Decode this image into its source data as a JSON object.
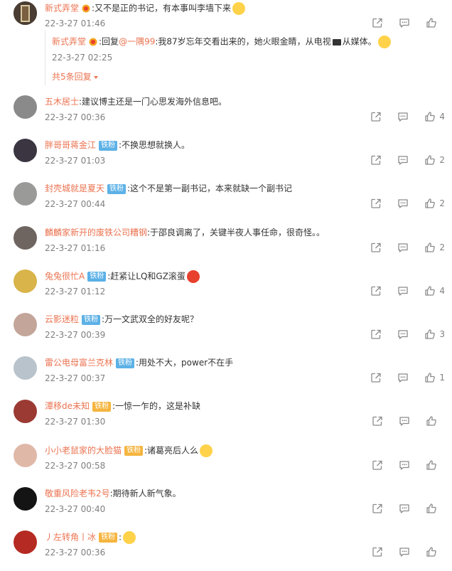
{
  "top_comment": {
    "user": "新式弄堂",
    "text": ":又不是正的书记，有本事叫李墙下来",
    "time": "22-3-27 01:46",
    "reply": {
      "user": "新式弄堂",
      "prefix": ":回复",
      "mention": "@一隅99",
      "text": ":我87岁忘年交看出来的，她火眼金睛，从电视",
      "text_after_tv": "从媒体。",
      "time": "22-3-27 02:25"
    },
    "more_replies": "共5条回复",
    "more_icon": "triangle-down-icon"
  },
  "comments": [
    {
      "user": "五木居士",
      "badge": "",
      "text": ":建议博主还是一门心思发海外信息吧。",
      "time": "22-3-27 00:36",
      "likes": "4",
      "avatar_color": "#8a8a8a"
    },
    {
      "user": "胖哥哥蒋金江",
      "badge": "铁粉",
      "text": ":不换思想就换人。",
      "time": "22-3-27 01:03",
      "likes": "2",
      "avatar_color": "#3a3540"
    },
    {
      "user": "封壳城就是夏天",
      "badge": "铁粉",
      "text": ":这个不是第一副书记，本来就缺一个副书记",
      "time": "22-3-27 00:44",
      "likes": "2",
      "avatar_color": "#9a9a98"
    },
    {
      "user": "麟麟家新开的废铁公司糟钢",
      "badge": "",
      "text": ":于邵良调离了，关键半夜人事任命，很奇怪。。",
      "time": "22-3-27 01:16",
      "likes": "2",
      "avatar_color": "#6e6460"
    },
    {
      "user": "兔兔很忙A",
      "badge": "铁粉",
      "text": ":赶紧让LQ和GZ滚蛋",
      "time": "22-3-27 01:12",
      "likes": "4",
      "avatar_color": "#d9b44a"
    },
    {
      "user": "云影迷粒",
      "badge": "铁粉",
      "text": ":万一文武双全的好友呢？",
      "time": "22-3-27 00:39",
      "likes": "3",
      "avatar_color": "#c4a59a"
    },
    {
      "user": "雷公电母富兰克林",
      "badge": "铁粉",
      "text": ":用处不大，power不在手",
      "time": "22-3-27 00:37",
      "likes": "1",
      "avatar_color": "#b9c3cc"
    },
    {
      "user": "潭移de未知",
      "badge": "铁粉",
      "text": ":一惊一乍的，这是补缺",
      "time": "22-3-27 01:30",
      "likes": "",
      "avatar_color": "#9b3a33"
    },
    {
      "user": "小小老鼠家的大脸猫",
      "badge": "铁粉",
      "text": ":诸葛亮后人么",
      "time": "22-3-27 00:58",
      "likes": "",
      "avatar_color": "#e0b8a8"
    },
    {
      "user": "敬重风险老韦2号",
      "badge": "",
      "text": ":期待新人新气象。",
      "time": "22-3-27 00:40",
      "likes": "",
      "avatar_color": "#141414"
    },
    {
      "user": "丿左转角丨冰",
      "badge": "铁粉",
      "text": ":",
      "time": "22-3-27 00:36",
      "likes": "",
      "avatar_color": "#b52a22"
    }
  ],
  "colors": {
    "username": "#eb7350",
    "text": "#333333",
    "time": "#808080",
    "icon": "#8b8b8b",
    "badge_fan": "#5cb1e6",
    "badge_gold": "#f5b53f"
  },
  "icons": {
    "forward": "forward-icon",
    "comment": "comment-icon",
    "like": "like-icon"
  }
}
